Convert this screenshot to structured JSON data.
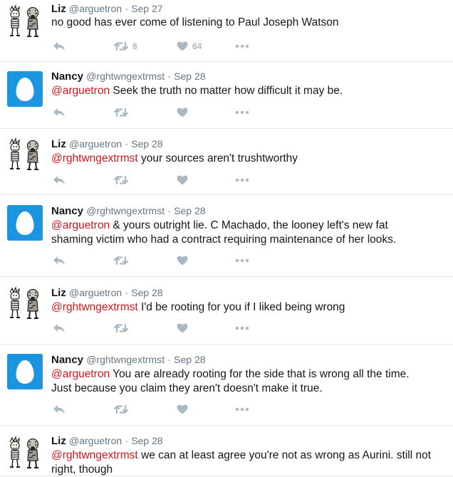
{
  "tweets": [
    {
      "name": "Liz",
      "handle": "@arguetron",
      "separator": "·",
      "date": "Sep 27",
      "mention": "",
      "text": "no good has ever come of listening to Paul Joseph Watson",
      "retweets": "8",
      "likes": "64",
      "avatar": "cartoon"
    },
    {
      "name": "Nancy",
      "handle": "@rghtwngextrmst",
      "separator": "·",
      "date": "Sep 28",
      "mention": "@arguetron",
      "text": " Seek the truth no matter how difficult it may be.",
      "retweets": "",
      "likes": "",
      "avatar": "egg"
    },
    {
      "name": "Liz",
      "handle": "@arguetron",
      "separator": "·",
      "date": "Sep 28",
      "mention": "@rghtwngextrmst",
      "text": " your sources aren't trushtworthy",
      "retweets": "",
      "likes": "",
      "avatar": "cartoon"
    },
    {
      "name": "Nancy",
      "handle": "@rghtwngextrmst",
      "separator": "·",
      "date": "Sep 28",
      "mention": "@arguetron",
      "text": " & yours outright lie. C Machado, the looney left's new fat shaming victim who had a contract requiring maintenance of her looks.",
      "retweets": "",
      "likes": "",
      "avatar": "egg"
    },
    {
      "name": "Liz",
      "handle": "@arguetron",
      "separator": "·",
      "date": "Sep 28",
      "mention": "@rghtwngextrmst",
      "text": " I'd be rooting for you if I liked being wrong",
      "retweets": "",
      "likes": "",
      "avatar": "cartoon"
    },
    {
      "name": "Nancy",
      "handle": "@rghtwngextrmst",
      "separator": "·",
      "date": "Sep 28",
      "mention": "@arguetron",
      "text": " You are already rooting for the side that is wrong all the time. Just because you claim they aren't doesn't make it true.",
      "retweets": "",
      "likes": "",
      "avatar": "egg"
    },
    {
      "name": "Liz",
      "handle": "@arguetron",
      "separator": "·",
      "date": "Sep 28",
      "mention": "@rghtwngextrmst",
      "text": " we can at least agree you're not as wrong as Aurini. still not right, though",
      "retweets": "",
      "likes": "",
      "avatar": "cartoon"
    }
  ],
  "colors": {
    "mention": "#d4161a",
    "egg_background": "#1b95e0",
    "action_icon": "#aab8c2",
    "muted_text": "#657786",
    "divider": "#e1e8ed"
  },
  "icons": [
    "reply-icon",
    "retweet-icon",
    "heart-icon",
    "more-icon",
    "egg-avatar-icon",
    "cartoon-avatar-icon"
  ]
}
